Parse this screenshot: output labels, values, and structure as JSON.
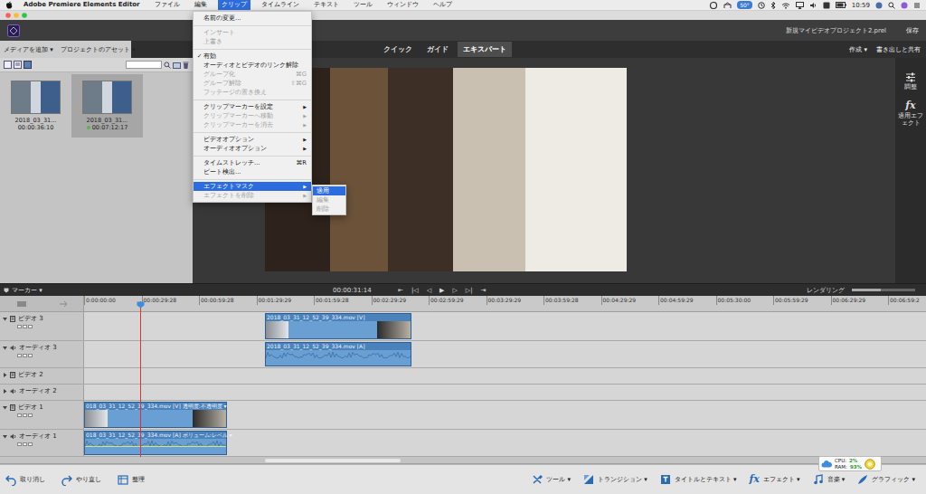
{
  "menubar": {
    "items": [
      {
        "label": "Adobe Premiere Elements Editor",
        "kind": "app",
        "selected": false
      },
      {
        "label": "ファイル",
        "kind": "menu",
        "selected": false
      },
      {
        "label": "編集",
        "kind": "menu",
        "selected": false
      },
      {
        "label": "クリップ",
        "kind": "menu",
        "selected": true
      },
      {
        "label": "タイムライン",
        "kind": "menu",
        "selected": false
      },
      {
        "label": "テキスト",
        "kind": "menu",
        "selected": false
      },
      {
        "label": "ツール",
        "kind": "menu",
        "selected": false
      },
      {
        "label": "ウィンドウ",
        "kind": "menu",
        "selected": false
      },
      {
        "label": "ヘルプ",
        "kind": "menu",
        "selected": false
      }
    ],
    "temperature": "50°",
    "time": "10:59"
  },
  "app": {
    "project": "新規マイビデオプロジェクト2.prel",
    "save": "保存"
  },
  "toolbar": {
    "add_media": "メディアを追加 ▾",
    "assets": "プロジェクトのアセット ▾",
    "modes": [
      {
        "label": "クイック",
        "selected": false
      },
      {
        "label": "ガイド",
        "selected": false
      },
      {
        "label": "エキスパート",
        "selected": true
      }
    ],
    "create": "作成 ▾",
    "export": "書き出しと共有"
  },
  "assets": [
    {
      "name": "2018_03_31...",
      "duration": "00:00:36:10",
      "selected": false,
      "in_timeline": false
    },
    {
      "name": "2018_03_31...",
      "duration": "00:07:12:17",
      "selected": true,
      "in_timeline": true
    }
  ],
  "side": [
    {
      "label": "調整",
      "kind": "adjust"
    },
    {
      "label": "適用エフェクト",
      "kind": "fx",
      "glyph": "fx"
    }
  ],
  "transport": {
    "marker": "マーカー ▾",
    "timecode": "00:00:31:14",
    "buttons": [
      "⇤",
      "|◁",
      "◁",
      "▶",
      "▷",
      "▷|",
      "⇥"
    ],
    "render": "レンダリング",
    "zoom": 0.45
  },
  "ruler": [
    "0:00:00:00",
    "00:00:29:28",
    "00:00:59:28",
    "00:01:29:29",
    "00:01:59:28",
    "00:02:29:29",
    "00:02:59:29",
    "00:03:29:29",
    "00:03:59:28",
    "00:04:29:29",
    "00:04:59:29",
    "00:05:30:00",
    "00:05:59:29",
    "00:06:29:29",
    "00:06:59:2"
  ],
  "tracks": [
    {
      "label": "ビデオ 3",
      "kind": "video",
      "expanded": true,
      "clips": [
        {
          "label": "2018_03_31_12_52_39_334.mov [V]"
        }
      ]
    },
    {
      "label": "オーディオ 3",
      "kind": "audio",
      "expanded": true,
      "clips": [
        {
          "label": "2018_03_31_12_52_39_334.mov [A]"
        }
      ]
    },
    {
      "label": "ビデオ 2",
      "kind": "video",
      "expanded": false,
      "clips": []
    },
    {
      "label": "オーディオ 2",
      "kind": "audio",
      "expanded": false,
      "clips": []
    },
    {
      "label": "ビデオ 1",
      "kind": "video",
      "expanded": true,
      "clips": [
        {
          "label": "018_03_31_12_52_39_334.mov [V] 透明度:不透明度 ▾"
        }
      ]
    },
    {
      "label": "オーディオ 1",
      "kind": "audio",
      "expanded": true,
      "clips": [
        {
          "label": "018_03_31_12_52_39_334.mov [A] ボリューム:レベル ▾"
        }
      ]
    }
  ],
  "bottom": {
    "left": [
      {
        "label": "取り消し",
        "kind": "undo"
      },
      {
        "label": "やり直し",
        "kind": "redo"
      },
      {
        "label": "整理",
        "kind": "organize"
      }
    ],
    "right": [
      {
        "label": "ツール ▾",
        "kind": "tools"
      },
      {
        "label": "トランジション ▾",
        "kind": "transition"
      },
      {
        "label": "タイトルとテキスト ▾",
        "kind": "title"
      },
      {
        "label": "エフェクト ▾",
        "kind": "fx",
        "glyph": "fx"
      },
      {
        "label": "音楽 ▾",
        "kind": "music"
      },
      {
        "label": "グラフィック ▾",
        "kind": "graphics"
      }
    ]
  },
  "cpu": {
    "cpu_label": "CPU:",
    "cpu": "2%",
    "ram_label": "RAM:",
    "ram": "93%"
  },
  "menu": {
    "check_glyph": "✓",
    "arrow": "▶",
    "items": [
      {
        "kind": "item",
        "label": "名前の変更...",
        "disabled": false,
        "selected": false,
        "checked": false,
        "submenu": false
      },
      {
        "kind": "separator"
      },
      {
        "kind": "item",
        "label": "インサート",
        "disabled": true,
        "selected": false,
        "checked": false,
        "submenu": false
      },
      {
        "kind": "item",
        "label": "上書き",
        "disabled": true,
        "selected": false,
        "checked": false,
        "submenu": false
      },
      {
        "kind": "separator"
      },
      {
        "kind": "item",
        "label": "有効",
        "disabled": false,
        "selected": false,
        "checked": true,
        "submenu": false
      },
      {
        "kind": "item",
        "label": "オーディオとビデオのリンク解除",
        "disabled": false,
        "selected": false,
        "checked": false,
        "submenu": false
      },
      {
        "kind": "item",
        "label": "グループ化",
        "shortcut": "⌘G",
        "disabled": true,
        "selected": false,
        "checked": false,
        "submenu": false
      },
      {
        "kind": "item",
        "label": "グループ解除",
        "shortcut": "⇧⌘G",
        "disabled": true,
        "selected": false,
        "checked": false,
        "submenu": false
      },
      {
        "kind": "item",
        "label": "フッテージの置き換え",
        "disabled": true,
        "selected": false,
        "checked": false,
        "submenu": false
      },
      {
        "kind": "separator"
      },
      {
        "kind": "item",
        "label": "クリップマーカーを設定",
        "disabled": false,
        "selected": false,
        "checked": false,
        "submenu": true
      },
      {
        "kind": "item",
        "label": "クリップマーカーへ移動",
        "disabled": true,
        "selected": false,
        "checked": false,
        "submenu": true
      },
      {
        "kind": "item",
        "label": "クリップマーカーを消去",
        "disabled": true,
        "selected": false,
        "checked": false,
        "submenu": true
      },
      {
        "kind": "separator"
      },
      {
        "kind": "item",
        "label": "ビデオオプション",
        "disabled": false,
        "selected": false,
        "checked": false,
        "submenu": true
      },
      {
        "kind": "item",
        "label": "オーディオオプション",
        "disabled": false,
        "selected": false,
        "checked": false,
        "submenu": true
      },
      {
        "kind": "separator"
      },
      {
        "kind": "item",
        "label": "タイムストレッチ...",
        "shortcut": "⌘R",
        "disabled": false,
        "selected": false,
        "checked": false,
        "submenu": false
      },
      {
        "kind": "item",
        "label": "ビート検出...",
        "disabled": false,
        "selected": false,
        "checked": false,
        "submenu": false
      },
      {
        "kind": "separator"
      },
      {
        "kind": "item",
        "label": "エフェクトマスク",
        "disabled": false,
        "selected": true,
        "checked": false,
        "submenu": true
      },
      {
        "kind": "item",
        "label": "エフェクトを削除",
        "disabled": true,
        "selected": false,
        "checked": false,
        "submenu": true
      }
    ]
  },
  "submenu": [
    {
      "label": "適用",
      "disabled": false,
      "selected": true
    },
    {
      "label": "編集",
      "disabled": true,
      "selected": false
    },
    {
      "label": "削除",
      "disabled": true,
      "selected": false
    }
  ]
}
